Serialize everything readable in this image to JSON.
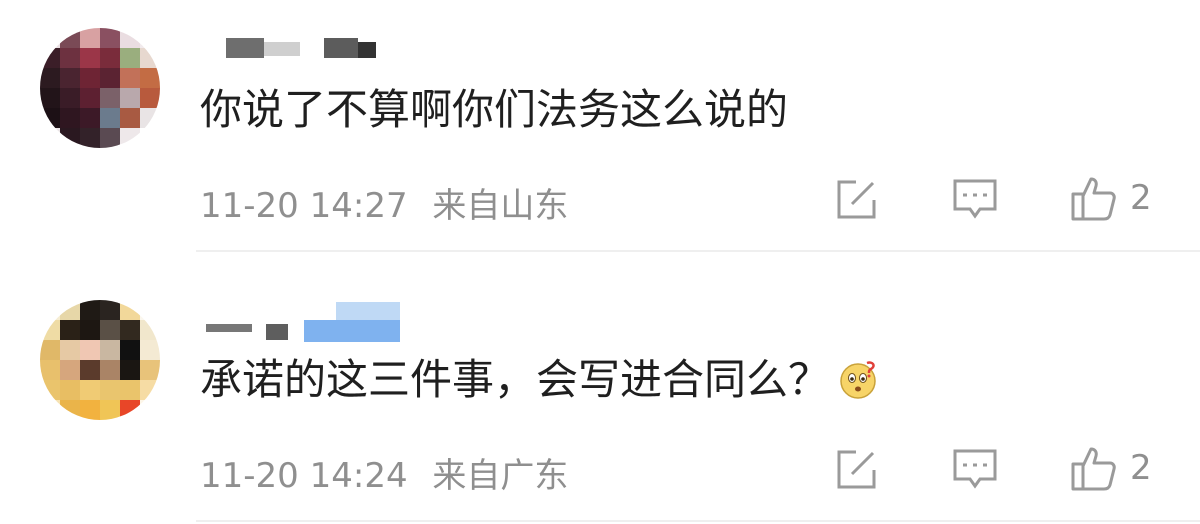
{
  "comments": [
    {
      "text": "你说了不算啊你们法务这么说的",
      "date": "11-20 14:27",
      "location": "来自山东",
      "likes": "2",
      "icons": [
        "edit-icon",
        "comment-icon",
        "thumbs-up-icon"
      ]
    },
    {
      "text": "承诺的这三件事，会写进合同么？",
      "emoji": "confused-face-emoji",
      "date": "11-20 14:24",
      "location": "来自广东",
      "likes": "2",
      "icons": [
        "edit-icon",
        "comment-icon",
        "thumbs-up-icon"
      ]
    }
  ],
  "colors": {
    "meta_text": "#8f8f8f",
    "main_text": "#1f1f1f",
    "username_highlight": "#7fb2ef"
  }
}
